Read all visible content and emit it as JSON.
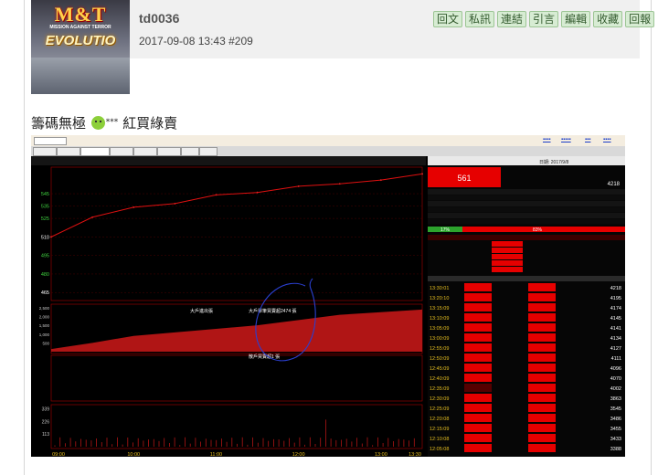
{
  "post": {
    "username": "td0036",
    "datetime": "2017-09-08 13:43",
    "post_number": "#209",
    "actions": [
      "回文",
      "私訊",
      "連結",
      "引言",
      "編輯",
      "收藏",
      "回報"
    ],
    "body_before": "籌碼無極",
    "emoji_suffix": "***",
    "body_after": "紅買綠賣"
  },
  "avatar": {
    "logo_top": "M&T",
    "logo_sub": "MISSION AGAINST TERROR",
    "logo_bottom": "EVOLUTIO"
  },
  "chart_data": {
    "type": "line",
    "price_axis_ticks": [
      "545",
      "535",
      "525",
      "510",
      "495",
      "480",
      "465"
    ],
    "volume_axis_ticks": [
      "2,500",
      "2,000",
      "1,500",
      "1,000",
      "500"
    ],
    "bottom_axis_ticks": [
      "339",
      "226",
      "113"
    ],
    "time_labels": [
      "09:00",
      "10:00",
      "11:00",
      "12:00",
      "13:00",
      "13:30"
    ],
    "x": [
      "09:00",
      "09:30",
      "10:00",
      "10:30",
      "11:00",
      "11:30",
      "12:00",
      "12:30",
      "13:00",
      "13:30"
    ],
    "price_series": [
      510,
      526,
      534,
      537,
      544,
      546,
      551,
      553,
      556,
      561
    ],
    "header_price": "561",
    "cumulative_volume_series": [
      150,
      500,
      900,
      1100,
      1300,
      1500,
      1800,
      2100,
      2250,
      2400
    ],
    "annotations": [
      "大戶進出張",
      "大戶單筆買賣超2474 張",
      "散戶買賣超1 張"
    ]
  },
  "quote": {
    "price": "561",
    "date_label": "日期: 2017/9/8",
    "total_volume": "4218",
    "inside_pct": "17%",
    "outside_pct": "83%",
    "ticks": [
      {
        "t": "13:30:01",
        "v": "4218"
      },
      {
        "t": "13:20:10",
        "v": "4195"
      },
      {
        "t": "13:15:09",
        "v": "4174"
      },
      {
        "t": "13:10:09",
        "v": "4145"
      },
      {
        "t": "13:05:09",
        "v": "4141"
      },
      {
        "t": "13:00:09",
        "v": "4134"
      },
      {
        "t": "12:55:09",
        "v": "4127"
      },
      {
        "t": "12:50:09",
        "v": "4111"
      },
      {
        "t": "12:45:09",
        "v": "4096"
      },
      {
        "t": "12:40:09",
        "v": "4070"
      },
      {
        "t": "12:35:09",
        "v": "4002"
      },
      {
        "t": "12:30:09",
        "v": "3863"
      },
      {
        "t": "12:25:09",
        "v": "3545"
      },
      {
        "t": "12:20:08",
        "v": "3486"
      },
      {
        "t": "12:15:09",
        "v": "3455"
      },
      {
        "t": "12:10:08",
        "v": "3433"
      },
      {
        "t": "12:05:08",
        "v": "3388"
      }
    ]
  }
}
